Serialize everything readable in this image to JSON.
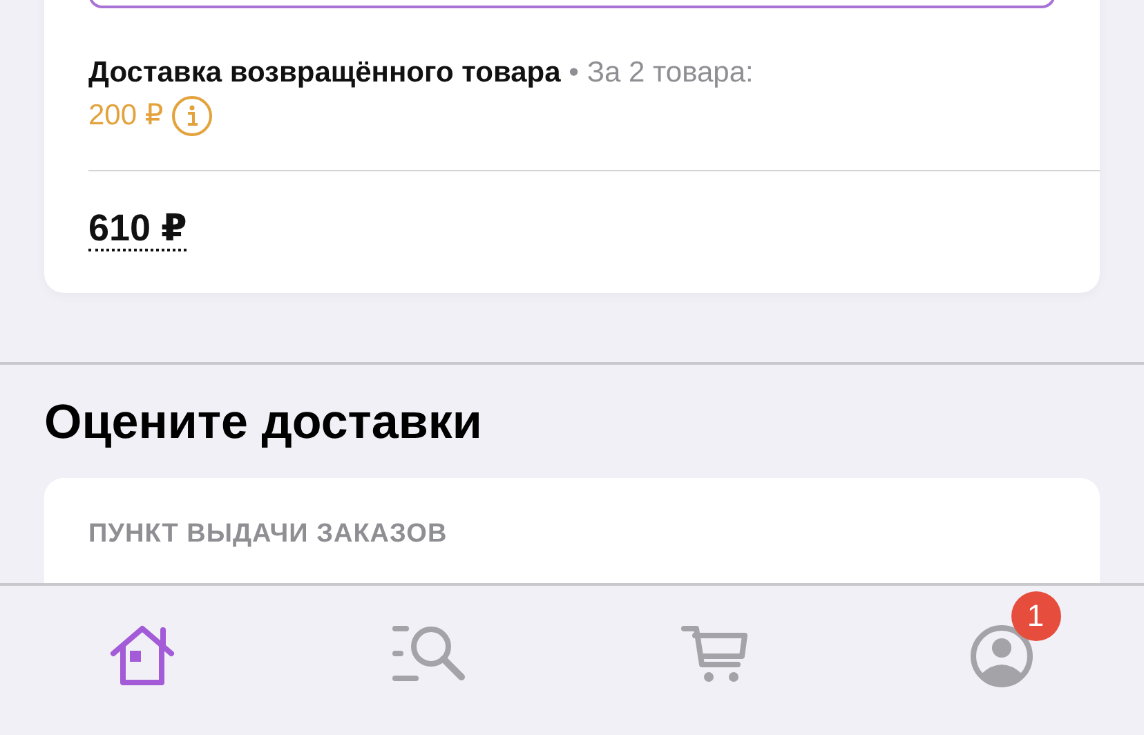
{
  "order_card": {
    "return_delivery": {
      "title": "Доставка возвращённого товара",
      "separator": "•",
      "note": "За 2 товара:",
      "price": "200 ₽"
    },
    "total": "610 ₽"
  },
  "rate_section": {
    "heading": "Оцените доставки",
    "card_label": "ПУНКТ ВЫДАЧИ ЗАКАЗОВ"
  },
  "tab_bar": [
    {
      "kind": "home",
      "selected": true
    },
    {
      "kind": "catalog",
      "selected": false
    },
    {
      "kind": "cart",
      "selected": false
    },
    {
      "kind": "profile",
      "selected": false,
      "badge": "1"
    }
  ]
}
